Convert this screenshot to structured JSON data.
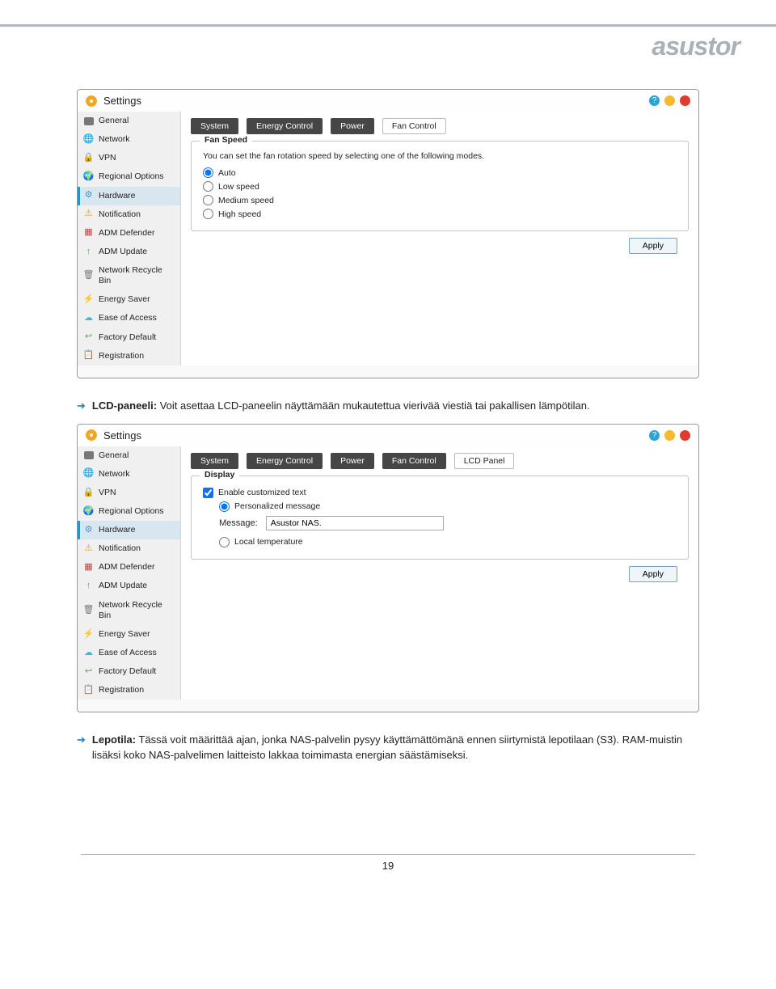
{
  "brand": "asustor",
  "page_number": "19",
  "window1": {
    "title": "Settings",
    "tabs": [
      "System",
      "Energy Control",
      "Power",
      "Fan Control"
    ],
    "active_tab_light": "Fan Control",
    "panel_legend": "Fan Speed",
    "description": "You can set the fan rotation speed by selecting one of the following modes.",
    "options": [
      "Auto",
      "Low speed",
      "Medium speed",
      "High speed"
    ],
    "selected": "Auto",
    "apply": "Apply"
  },
  "window2": {
    "title": "Settings",
    "tabs": [
      "System",
      "Energy Control",
      "Power",
      "Fan Control",
      "LCD Panel"
    ],
    "active_tab_light": "LCD Panel",
    "panel_legend": "Display",
    "enable_label": "Enable customized text",
    "radio_personal": "Personalized message",
    "message_label": "Message:",
    "message_value": "Asustor NAS.",
    "radio_local": "Local temperature",
    "apply": "Apply"
  },
  "sidebar": [
    {
      "label": "General",
      "icon": "box"
    },
    {
      "label": "Network",
      "icon": "globe"
    },
    {
      "label": "VPN",
      "icon": "vpn"
    },
    {
      "label": "Regional Options",
      "icon": "regional"
    },
    {
      "label": "Hardware",
      "icon": "hw"
    },
    {
      "label": "Notification",
      "icon": "notif"
    },
    {
      "label": "ADM Defender",
      "icon": "def"
    },
    {
      "label": "ADM Update",
      "icon": "up"
    },
    {
      "label": "Network Recycle Bin",
      "icon": "bin"
    },
    {
      "label": "Energy Saver",
      "icon": "energy"
    },
    {
      "label": "Ease of Access",
      "icon": "ease"
    },
    {
      "label": "Factory Default",
      "icon": "factory"
    },
    {
      "label": "Registration",
      "icon": "reg"
    }
  ],
  "para1_bold": "LCD-paneeli:",
  "para1_rest": " Voit asettaa LCD-paneelin näyttämään mukautettua vierivää viestiä tai pakallisen lämpötilan.",
  "para2_bold": "Lepotila:",
  "para2_rest": " Tässä voit määrittää ajan, jonka NAS-palvelin pysyy käyttämättömänä ennen siirtymistä lepotilaan (S3). RAM-muistin lisäksi koko NAS-palvelimen laitteisto lakkaa toimimasta energian säästämiseksi."
}
